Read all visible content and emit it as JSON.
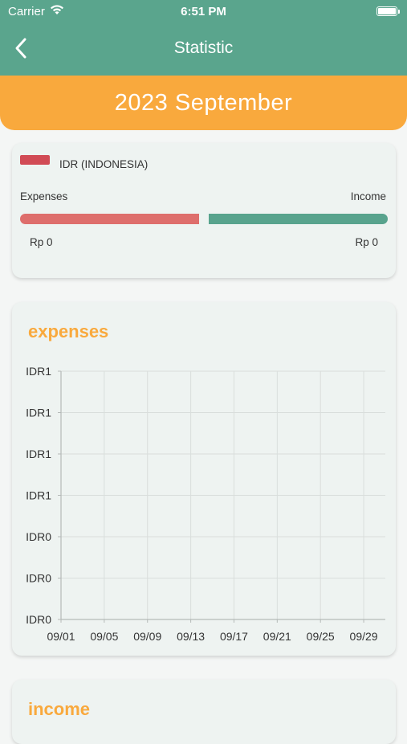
{
  "status": {
    "carrier": "Carrier",
    "time": "6:51 PM"
  },
  "nav": {
    "title": "Statistic",
    "back_icon": "chevron-left-icon"
  },
  "month": "2023 September",
  "summary": {
    "currency": "IDR (INDONESIA)",
    "expenses_label": "Expenses",
    "income_label": "Income",
    "expenses_value": "Rp  0",
    "income_value": "Rp  0",
    "colors": {
      "expenses": "#de6e6c",
      "income": "#58a38d",
      "flag": "#d14b55"
    }
  },
  "expenses_section": {
    "title": "expenses"
  },
  "income_section": {
    "title": "income"
  },
  "chart_data": {
    "type": "line",
    "title": "expenses",
    "categories": [
      "09/01",
      "09/05",
      "09/09",
      "09/13",
      "09/17",
      "09/21",
      "09/25",
      "09/29"
    ],
    "y_tick_labels": [
      "IDR1",
      "IDR1",
      "IDR1",
      "IDR1",
      "IDR0",
      "IDR0",
      "IDR0"
    ],
    "series": [],
    "grid": true
  },
  "colors": {
    "header": "#5aa58d",
    "accent": "#f9a93d",
    "card": "#eef3f1"
  }
}
